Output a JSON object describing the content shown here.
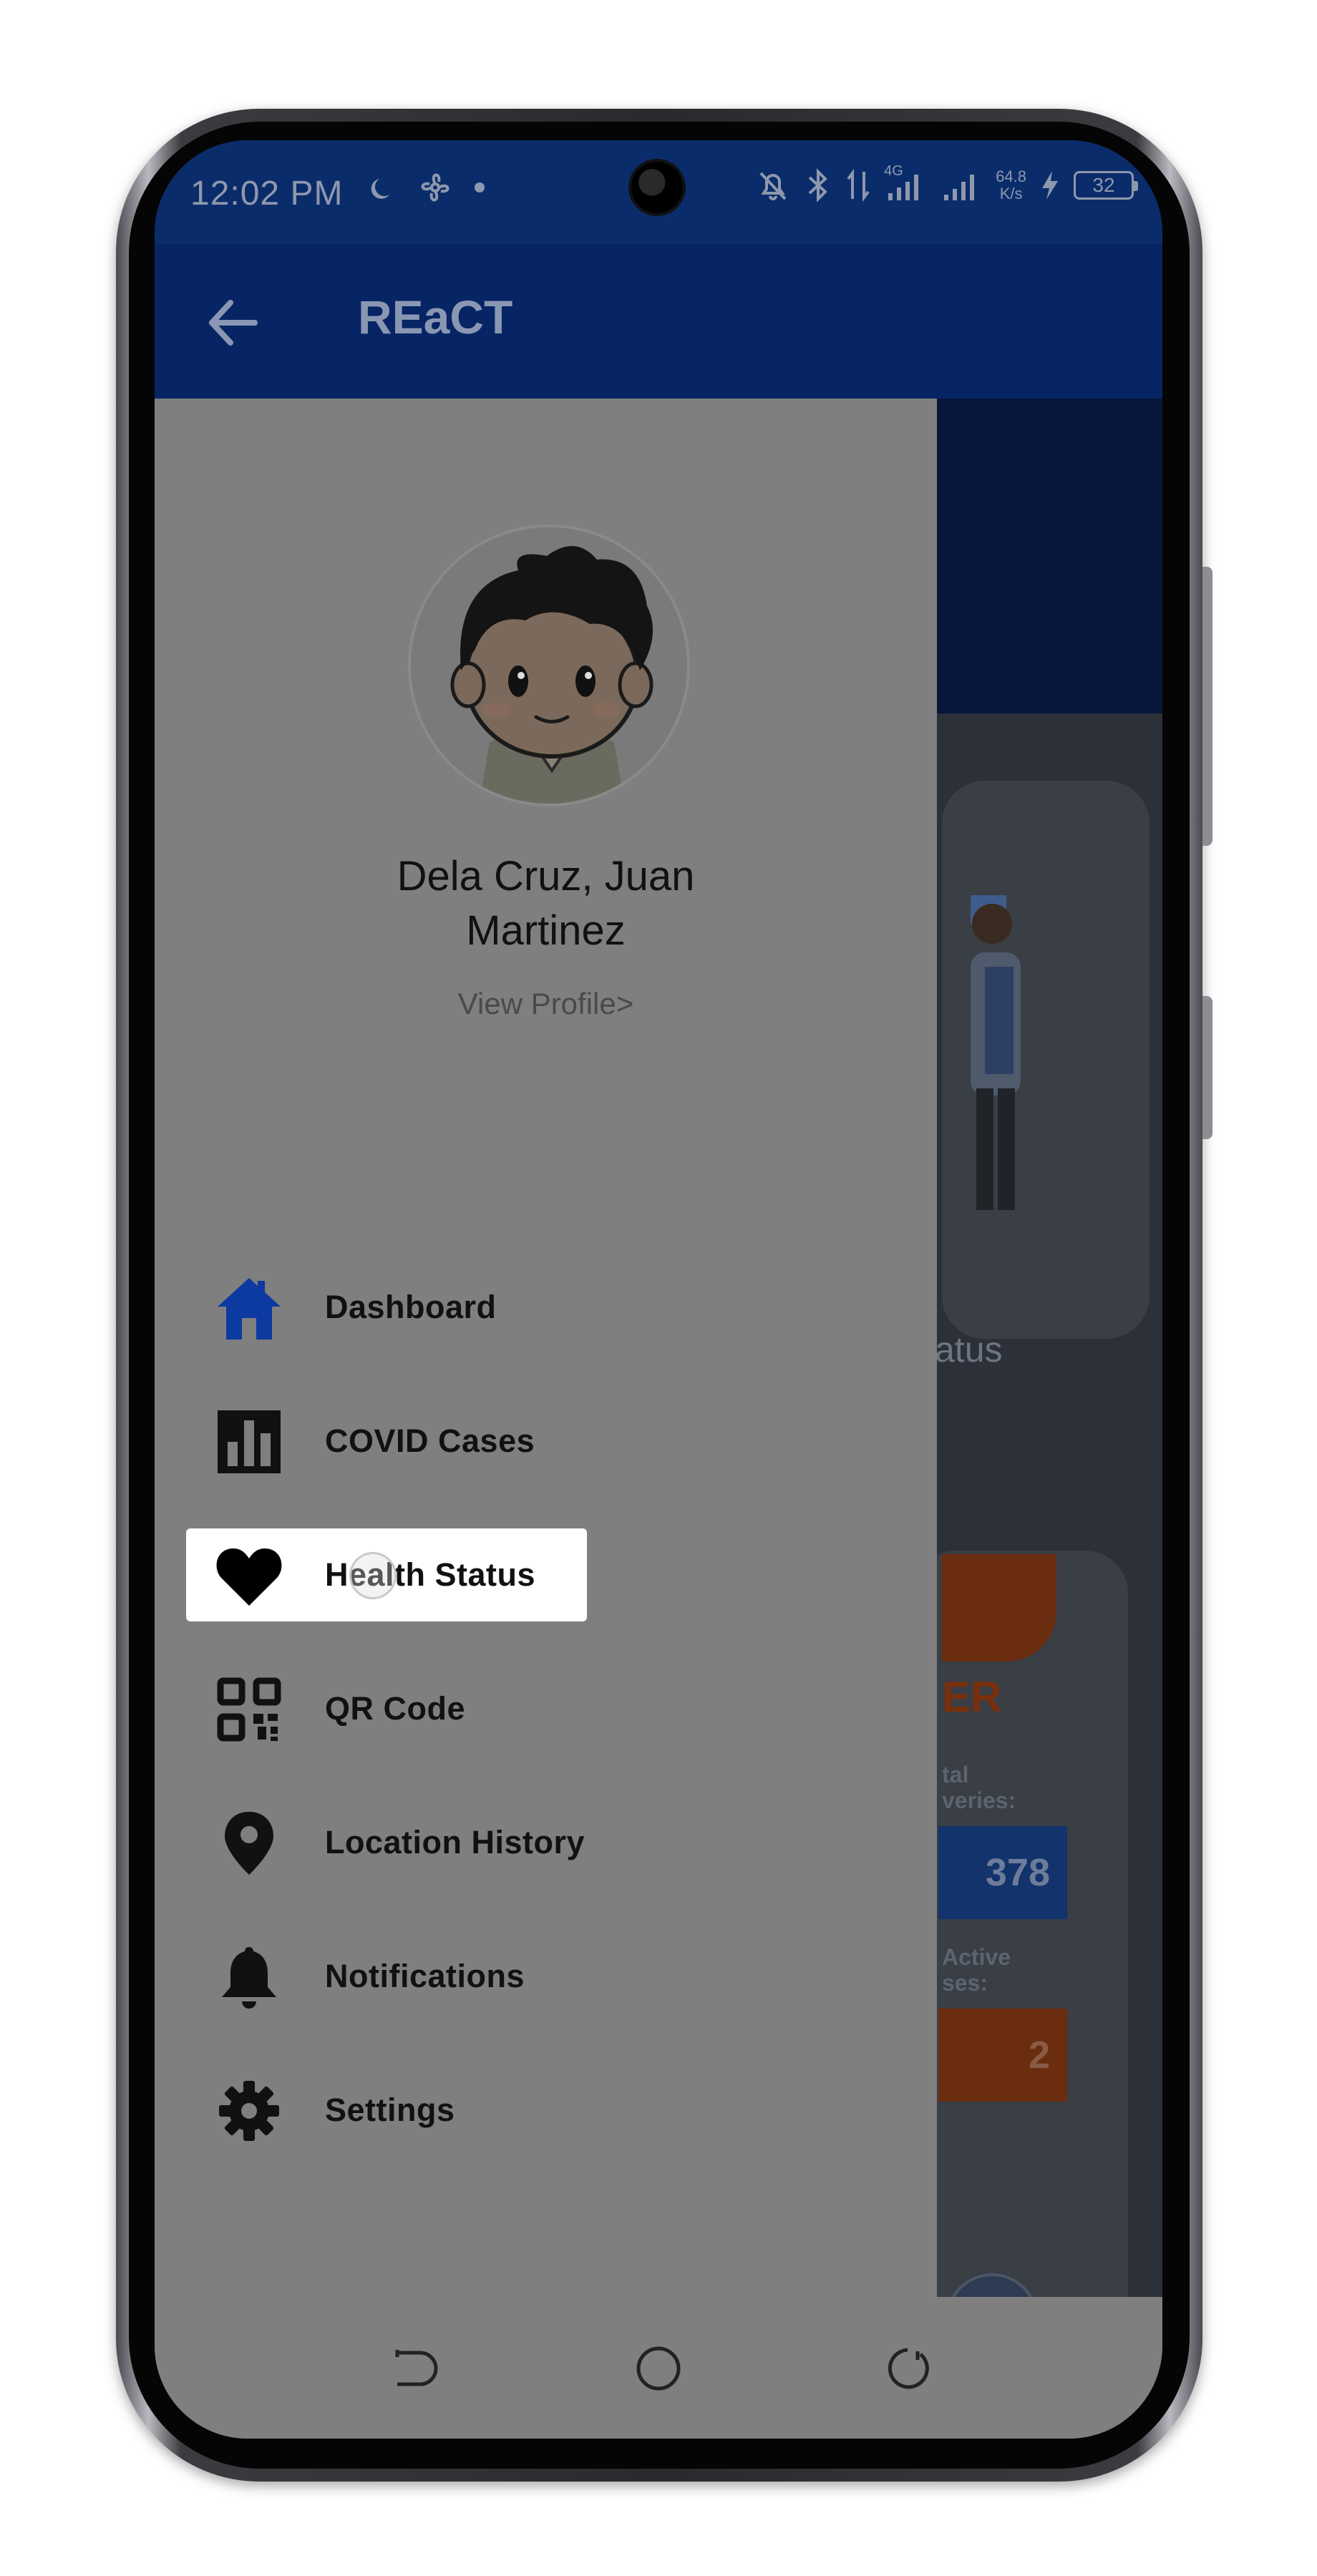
{
  "status_bar": {
    "time": "12:02 PM",
    "network_type": "4G",
    "net_speed_value": "64.8",
    "net_speed_unit": "K/s",
    "battery_level": "32"
  },
  "app_bar": {
    "title": "REaCT"
  },
  "profile": {
    "name_line1": "Dela Cruz, Juan",
    "name_line2": "Martinez",
    "view_profile_link": "View Profile>"
  },
  "menu": {
    "items": [
      {
        "label": "Dashboard",
        "icon": "home-icon",
        "active": false
      },
      {
        "label": "COVID Cases",
        "icon": "bar-chart-icon",
        "active": false
      },
      {
        "label": "Health Status",
        "icon": "heart-icon",
        "active": true
      },
      {
        "label": "QR Code",
        "icon": "qr-code-icon",
        "active": false
      },
      {
        "label": "Location History",
        "icon": "location-pin-icon",
        "active": false
      },
      {
        "label": "Notifications",
        "icon": "bell-icon",
        "active": false
      },
      {
        "label": "Settings",
        "icon": "gear-icon",
        "active": false
      }
    ]
  },
  "background_content": {
    "status_fragment": "atus",
    "card_title_fragment": "ER",
    "recoveries_label": [
      "tal",
      "veries:"
    ],
    "recoveries_value_fragment": "378",
    "active_label": [
      "Active",
      "ses:"
    ],
    "active_value_fragment": "2"
  },
  "colors": {
    "primary_dark": "#072565",
    "drawer_scrim": "#7f7f7f",
    "active_item_bg": "#ffffff",
    "dashboard_icon": "#0d3aa0"
  }
}
